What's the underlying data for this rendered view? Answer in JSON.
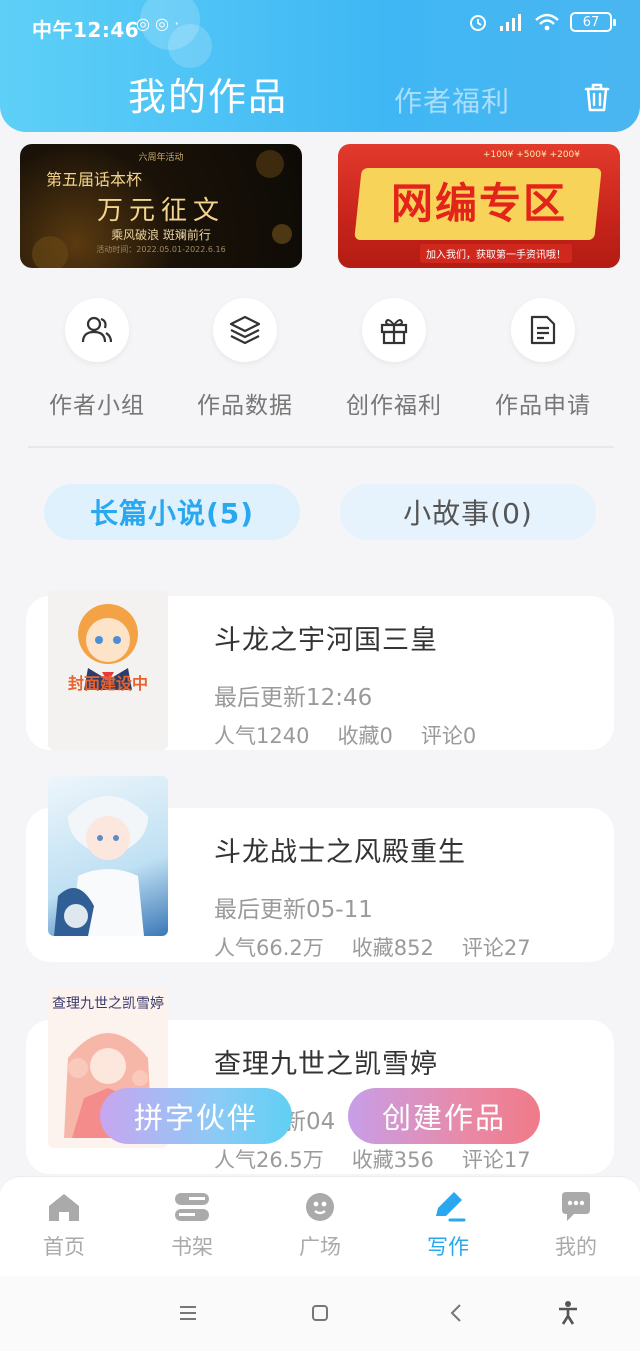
{
  "status_bar": {
    "time": "中午12:46",
    "battery": "67"
  },
  "header": {
    "title": "我的作品",
    "subtitle_tab": "作者福利"
  },
  "banners": {
    "left": {
      "top_small": "六周年活动",
      "line1": "第五届话本杯",
      "line2": "万元征文",
      "line3": "乘风破浪 斑斓前行",
      "line4": "活动时间：2022.05.01-2022.6.16"
    },
    "right": {
      "money": "+100¥ +500¥ +200¥",
      "title": "网编专区",
      "tag": "加入我们，获取第一手资讯哦！"
    }
  },
  "quick_actions": [
    {
      "label": "作者小组",
      "icon": "users-icon"
    },
    {
      "label": "作品数据",
      "icon": "layers-icon"
    },
    {
      "label": "创作福利",
      "icon": "gift-icon"
    },
    {
      "label": "作品申请",
      "icon": "document-icon"
    }
  ],
  "tabs": {
    "active": "长篇小说(5)",
    "inactive": "小故事(0)"
  },
  "works": [
    {
      "title": "斗龙之宇河国三皇",
      "updated": "最后更新12:46",
      "popularity": "人气1240",
      "favorites": "收藏0",
      "comments": "评论0",
      "cover_text": "封面建设中"
    },
    {
      "title": "斗龙战士之风殿重生",
      "updated": "最后更新05-11",
      "popularity": "人气66.2万",
      "favorites": "收藏852",
      "comments": "评论27"
    },
    {
      "title": "查理九世之凯雪婷",
      "updated": "最后更新04",
      "popularity": "人气26.5万",
      "favorites": "收藏356",
      "comments": "评论17",
      "cover_text": "查理九世之凯雪婷"
    }
  ],
  "floating_buttons": {
    "left": "拼字伙伴",
    "right": "创建作品"
  },
  "bottom_nav": [
    {
      "label": "首页",
      "icon": "home-icon"
    },
    {
      "label": "书架",
      "icon": "bookshelf-icon"
    },
    {
      "label": "广场",
      "icon": "planet-icon"
    },
    {
      "label": "写作",
      "icon": "pen-icon",
      "active": true
    },
    {
      "label": "我的",
      "icon": "chat-icon"
    }
  ],
  "colors": {
    "accent": "#2aa8ef",
    "header_gradient_start": "#5ed0f7",
    "header_gradient_end": "#3fb7f4"
  }
}
